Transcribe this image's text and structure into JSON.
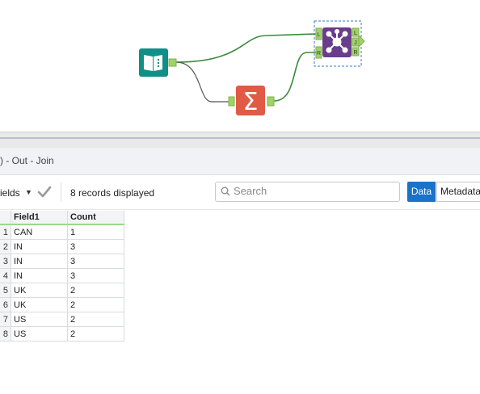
{
  "workflow": {
    "nodes": [
      {
        "name": "input-tool",
        "icon": "book-icon",
        "color": "#0f8f87"
      },
      {
        "name": "summarize-tool",
        "icon": "sigma-icon",
        "color": "#e05a45"
      },
      {
        "name": "join-tool",
        "icon": "join-icon",
        "color": "#6a3d8a"
      }
    ],
    "join_anchors": {
      "left": "L",
      "right": "R",
      "join_out": "J",
      "left_out": "L",
      "right_out": "R"
    },
    "connection_color": "#3c8a3c"
  },
  "results": {
    "title": ") - Out - Join",
    "fields_label": "ields",
    "records_label": "8 records displayed",
    "search_placeholder": "Search",
    "data_button": "Data",
    "metadata_button": "Metadata",
    "accent_color": "#1a73c9"
  },
  "table": {
    "columns": [
      "Field1",
      "Count"
    ],
    "rows": [
      {
        "n": "1",
        "field1": "CAN",
        "count": "1"
      },
      {
        "n": "2",
        "field1": "IN",
        "count": "3"
      },
      {
        "n": "3",
        "field1": "IN",
        "count": "3"
      },
      {
        "n": "4",
        "field1": "IN",
        "count": "3"
      },
      {
        "n": "5",
        "field1": "UK",
        "count": "2"
      },
      {
        "n": "6",
        "field1": "UK",
        "count": "2"
      },
      {
        "n": "7",
        "field1": "US",
        "count": "2"
      },
      {
        "n": "8",
        "field1": "US",
        "count": "2"
      }
    ]
  }
}
